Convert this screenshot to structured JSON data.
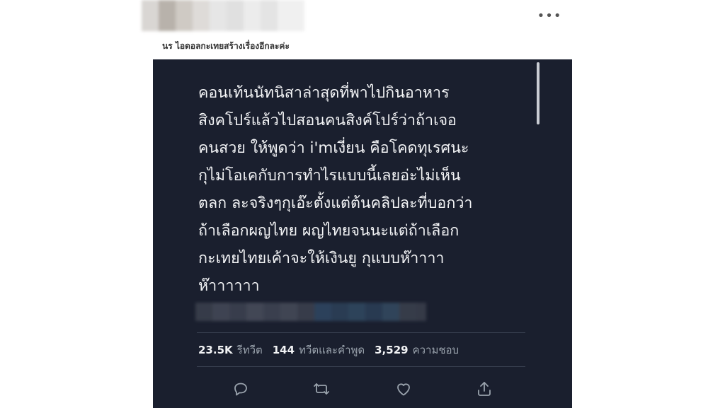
{
  "header": {
    "more_label": "•••",
    "quoted_text": "นร ไอดอลกะเทยสร้างเรื่องอีกละค่ะ"
  },
  "tweet": {
    "lines": [
      "คอนเท้นนัทนิสาล่าสุดที่พาไปกินอาหาร",
      "สิงคโปร์แล้วไปสอนคนสิงค์โปร์ว่าถ้าเจอ",
      "คนสวย ให้พูดว่า i'mเงี่ยน คือโคดทุเรศนะ",
      "กุไม่โอเคกับการทำไรแบบนี้เลยอ่ะไม่เห็น",
      "ตลก ละจริงๆกุเอ๊ะตั้งแต่ต้นคลิปละที่บอกว่า",
      "ถ้าเลือกผญไทย ผญไทยจนนะแต่ถ้าเลือก",
      "กะเทยไทยเค้าจะให้เงินยู กุแบบห๊าาาา",
      "ห๊าาาาาา"
    ]
  },
  "stats": {
    "retweets_count": "23.5K",
    "retweets_label": "รีทวีต",
    "quotes_count": "144",
    "quotes_label": "ทวีตและคำพูด",
    "likes_count": "3,529",
    "likes_label": "ความชอบ"
  },
  "icons": {
    "reply": "reply-icon",
    "retweet": "retweet-icon",
    "like": "heart-icon",
    "share": "share-icon",
    "more": "more-icon"
  },
  "colors": {
    "card_background": "#1a1f2e",
    "text_primary": "#f2f3f5",
    "text_secondary": "#9aa3ad",
    "icon": "#9aa3ad"
  }
}
